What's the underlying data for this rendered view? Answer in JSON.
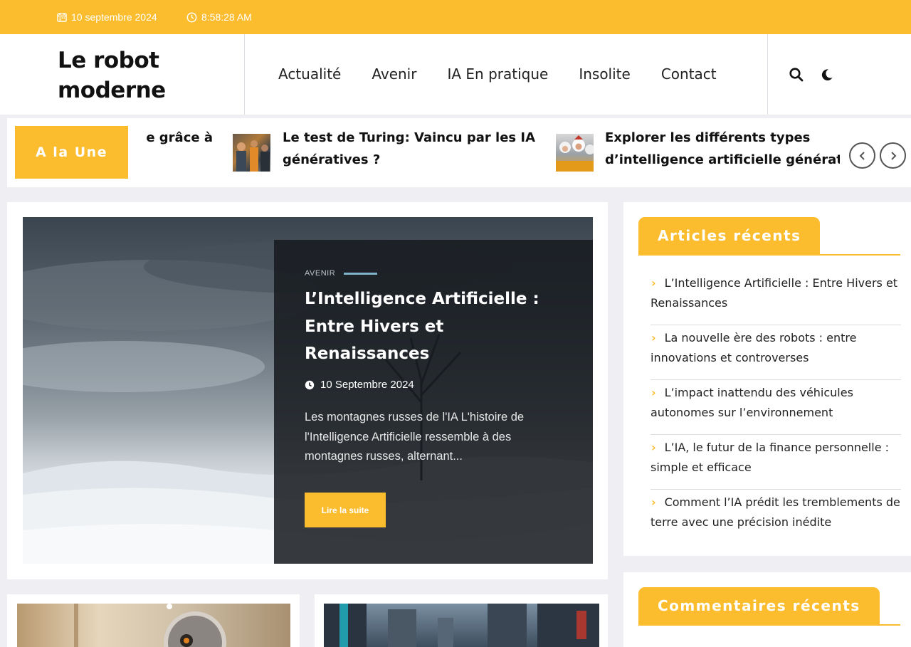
{
  "topbar": {
    "date": "10 septembre 2024",
    "time": "8:58:28 AM"
  },
  "header": {
    "logo": "Le robot moderne",
    "nav": [
      "Actualité",
      "Avenir",
      "IA En pratique",
      "Insolite",
      "Contact"
    ]
  },
  "ticker": {
    "label": "A la Une",
    "items": [
      {
        "title_line1": "e grâce à",
        "title_line2": ""
      },
      {
        "title_line1": "Le test de Turing: Vaincu par les IA",
        "title_line2": "génératives ?"
      },
      {
        "title_line1": "Explorer les différents types",
        "title_line2": "d’intelligence artificielle générative"
      }
    ]
  },
  "featured": {
    "category": "AVENIR",
    "title": "L’Intelligence Artificielle : Entre Hivers et Renaissances",
    "date": "10 Septembre 2024",
    "excerpt": "Les montagnes russes de l'IA L'histoire de l'Intelligence Artificielle ressemble à des montagnes russes, alternant...",
    "button": "Lire la suite"
  },
  "sidebar": {
    "recent_title": "Articles récents",
    "recent": [
      "L’Intelligence Artificielle : Entre Hivers et Renaissances",
      "La nouvelle ère des robots : entre innovations et controverses",
      "L’impact inattendu des véhicules autonomes sur l’environnement",
      "L’IA, le futur de la finance personnelle : simple et efficace",
      "Comment l’IA prédit les tremblements de terre avec une précision inédite"
    ],
    "comments_title": "Commentaires récents"
  },
  "colors": {
    "accent": "#fbbd2e",
    "page_bg": "#eeeef3",
    "overlay": "#1a1e22"
  },
  "icons": [
    "calendar-icon",
    "clock-icon",
    "search-icon",
    "moon-icon",
    "chevron-left-icon",
    "chevron-right-icon",
    "chevron-right-small-icon"
  ]
}
